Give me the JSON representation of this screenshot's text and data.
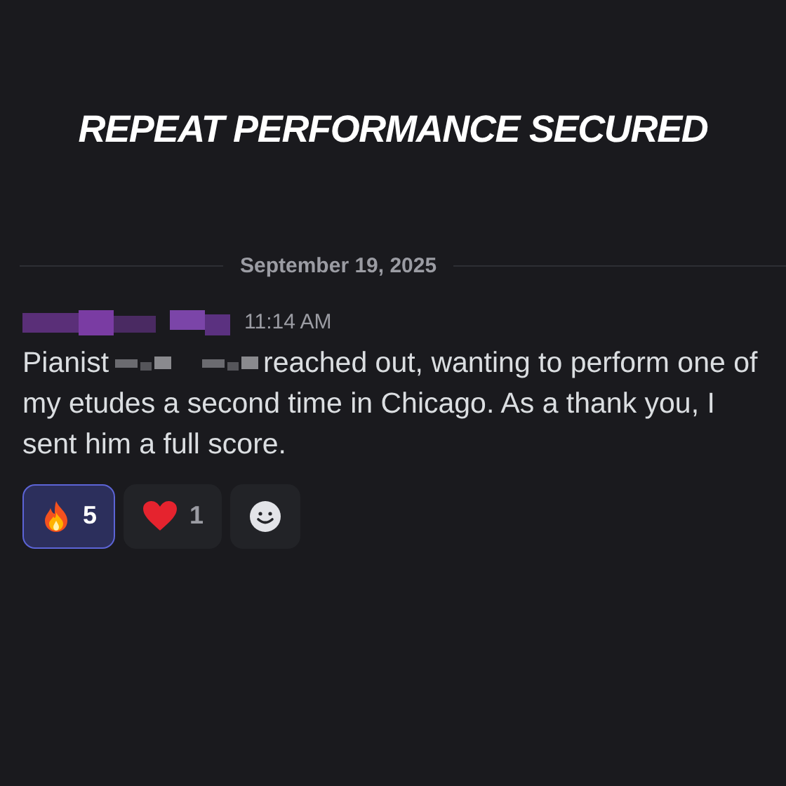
{
  "headline": "REPEAT PERFORMANCE SECURED",
  "date_divider": "September 19, 2025",
  "message": {
    "timestamp": "11:14 AM",
    "text_before": "Pianist",
    "text_after": "reached out, wanting to perform one of my etudes a second time in Chicago. As a thank you, I sent him a full score."
  },
  "reactions": [
    {
      "kind": "fire",
      "count": "5",
      "selected": true
    },
    {
      "kind": "heart",
      "count": "1",
      "selected": false
    }
  ]
}
